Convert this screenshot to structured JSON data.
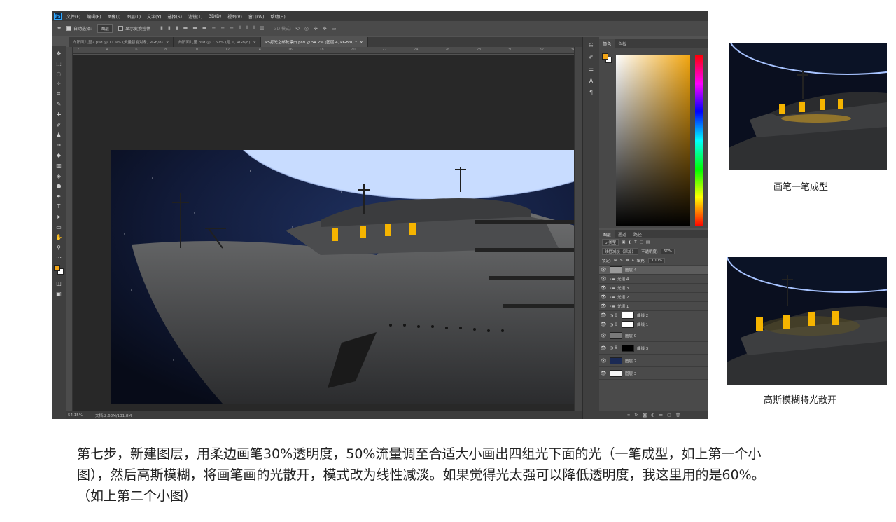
{
  "app": {
    "logo": "Ps",
    "menu": [
      "文件(F)",
      "编辑(E)",
      "图像(I)",
      "图层(L)",
      "文字(Y)",
      "选择(S)",
      "滤镜(T)",
      "3D(D)",
      "视图(V)",
      "窗口(W)",
      "帮助(H)"
    ]
  },
  "options": {
    "tool_symbol": "✥",
    "auto_select_label": "自动选择:",
    "auto_select_value": "图层",
    "show_transform_label": "显示变换控件",
    "mode_3d_label": "3D 模式:"
  },
  "tabs": [
    {
      "label": "向阳面儿里2.psd @ 11.9% (矢量智能对象, RGB/8)",
      "close": "×"
    },
    {
      "label": "向阳面儿里.psd @ 7.67% (组 1, RGB/8)",
      "close": "×"
    },
    {
      "label": "PS打光之邮轮漂白.psd @ 54.2% (图层 4, RGB/8) *",
      "close": "×"
    }
  ],
  "ruler_ticks": [
    "2",
    "4",
    "6",
    "8",
    "10",
    "12",
    "14",
    "16",
    "18",
    "20",
    "22",
    "24",
    "26",
    "28",
    "30",
    "32",
    "34"
  ],
  "status": {
    "zoom": "54.15%",
    "doc": "文档:2.63M/131.8M"
  },
  "color_panel": {
    "tabs": [
      "颜色",
      "色板"
    ],
    "foreground": "#f2a516",
    "background": "#ffffff"
  },
  "layers_panel": {
    "tabs": [
      "图层",
      "通道",
      "路径"
    ],
    "filter_label": "ρ 类型",
    "blend_mode": "线性减淡（添加）",
    "opacity_label": "不透明度:",
    "opacity_value": "60%",
    "lock_label": "锁定:",
    "fill_label": "填充:",
    "fill_value": "100%",
    "layers": [
      {
        "name": "图层 4",
        "type": "layer",
        "selected": true,
        "thumb": "#9a9a9a"
      },
      {
        "name": "光组 4",
        "type": "group"
      },
      {
        "name": "光组 3",
        "type": "group"
      },
      {
        "name": "光组 2",
        "type": "group"
      },
      {
        "name": "光组 1",
        "type": "group"
      },
      {
        "name": "曲线 2",
        "type": "adjust"
      },
      {
        "name": "曲线 1",
        "type": "adjust"
      },
      {
        "name": "图层 0",
        "type": "layer",
        "thumb": "#7a7a7a"
      },
      {
        "name": "曲线 3",
        "type": "adjust-mask"
      },
      {
        "name": "图层 2",
        "type": "layer",
        "thumb": "#1b2a55"
      },
      {
        "name": "图层 3",
        "type": "layer",
        "thumb": "#f4f4f4"
      }
    ]
  },
  "captions": {
    "first": "画笔一笔成型",
    "second": "高斯模糊将光散开"
  },
  "body": {
    "line1": "第七步，新建图层，用柔边画笔30%透明度，50%流量调至合适大小画出四组光下面的光（一笔成型，如上第一个小",
    "line2": "图），然后高斯模糊，将画笔画的光散开，模式改为线性减淡。如果觉得光太强可以降低透明度，我这里用的是60%。",
    "line3": "（如上第二个小图）"
  }
}
